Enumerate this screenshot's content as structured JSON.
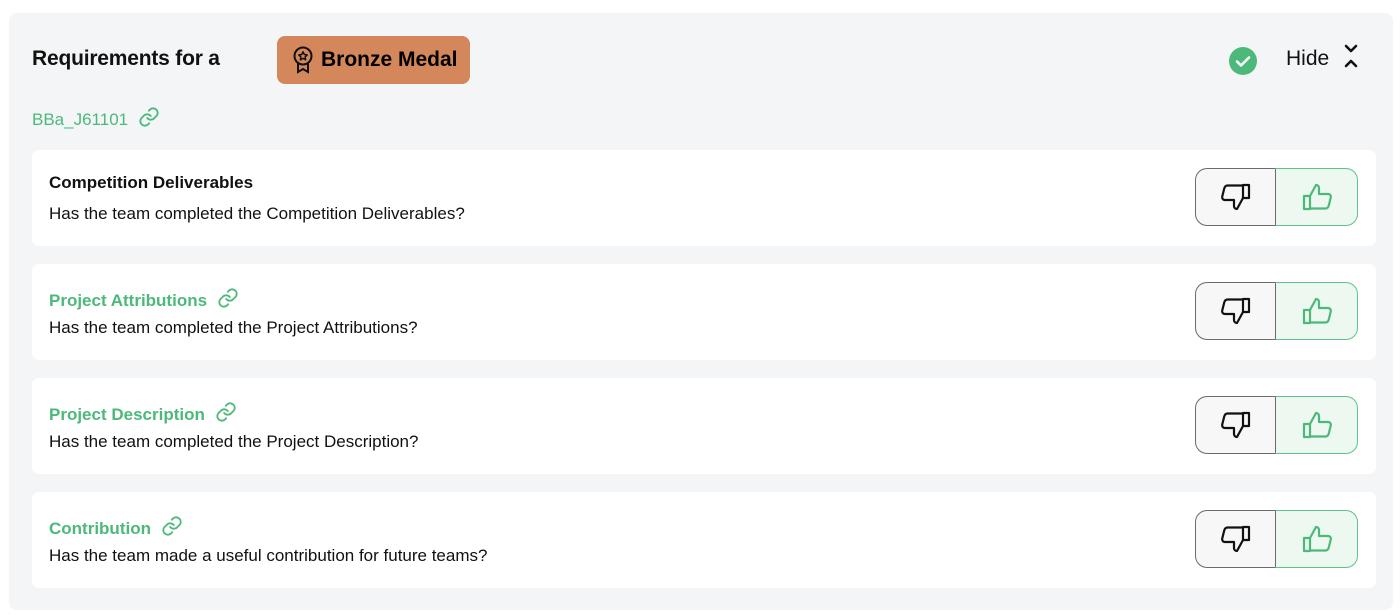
{
  "header": {
    "title": "Requirements for a",
    "medal_label": "Bronze Medal",
    "hide_label": "Hide"
  },
  "reference": {
    "label": "BBa_J61101"
  },
  "requirements": [
    {
      "title": "Competition Deliverables",
      "question": "Has the team completed the Competition Deliverables?",
      "linked": false
    },
    {
      "title": "Project Attributions",
      "question": "Has the team completed the Project Attributions?",
      "linked": true
    },
    {
      "title": "Project Description",
      "question": "Has the team completed the Project Description?",
      "linked": true
    },
    {
      "title": "Contribution",
      "question": "Has the team made a useful contribution for future teams?",
      "linked": true
    }
  ],
  "colors": {
    "accent_green": "#4cb97a",
    "medal_bronze": "#d4875a",
    "panel_bg": "#f4f5f7"
  },
  "icons": {
    "medal": "award-ribbon-icon",
    "status": "check-circle-icon",
    "hide": "chevrons-collapse-icon",
    "link": "link-icon",
    "vote_down": "thumbs-down-icon",
    "vote_up": "thumbs-up-icon"
  }
}
